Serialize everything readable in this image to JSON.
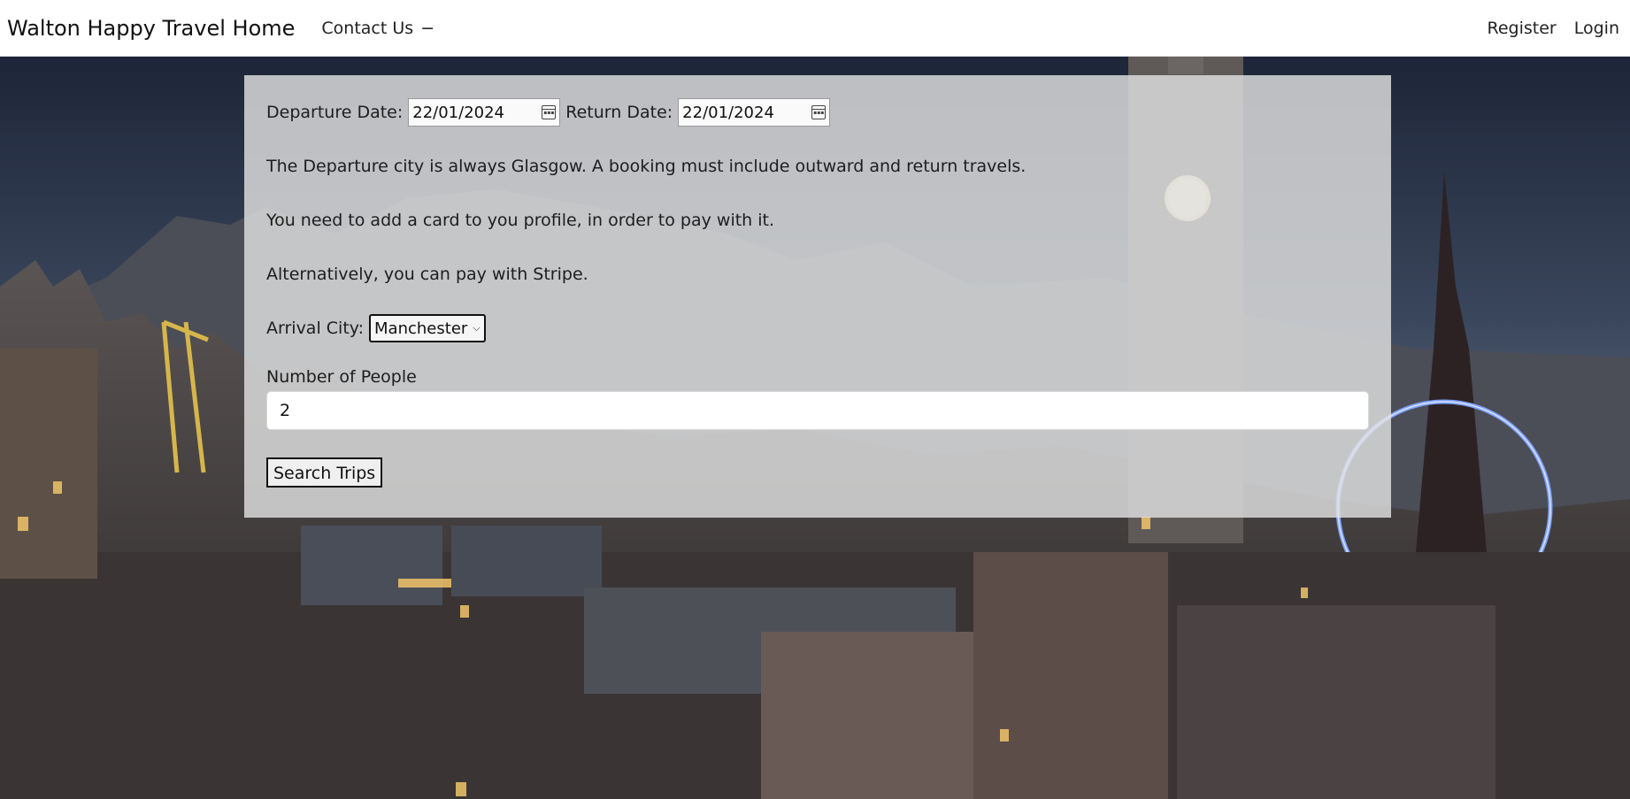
{
  "nav": {
    "brand": "Walton Happy Travel Home",
    "contact": "Contact Us",
    "contact_caret": "−",
    "register": "Register",
    "login": "Login"
  },
  "form": {
    "departure_label": "Departure Date:",
    "departure_value": "22/01/2024",
    "return_label": "Return Date:",
    "return_value": "22/01/2024",
    "info_1": "The Departure city is always Glasgow. A booking must include outward and return travels.",
    "info_2": "You need to add a card to you profile, in order to pay with it.",
    "info_3": "Alternatively, you can pay with Stripe.",
    "arrival_label": "Arrival City:",
    "arrival_selected": "Manchester",
    "people_label": "Number of People",
    "people_value": "2",
    "search_button": "Search Trips"
  },
  "icons": {
    "calendar": "calendar-icon",
    "dropdown": "chevron-down-icon"
  },
  "colors": {
    "navbar_bg": "#ffffff",
    "panel_bg": "#e1e1e1",
    "sky_top": "#20283a",
    "sky_bottom": "#48566d"
  }
}
